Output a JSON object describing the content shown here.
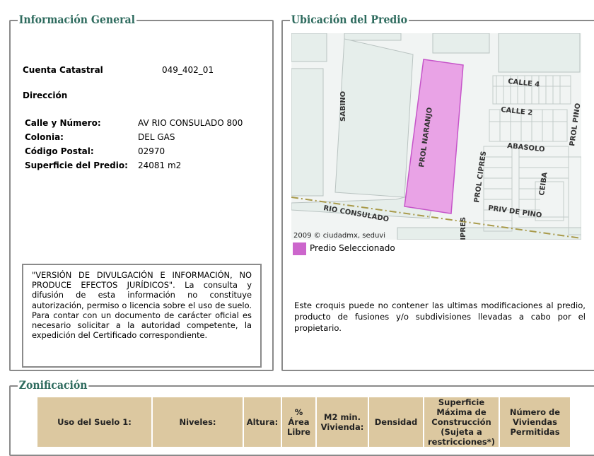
{
  "info_general": {
    "title": "Información General",
    "cuenta_label": "Cuenta Catastral",
    "cuenta_value": "049_402_01",
    "direccion_label": "Dirección",
    "fields": [
      {
        "label": "Calle y Número:",
        "value": "AV RIO CONSULADO 800"
      },
      {
        "label": "Colonia:",
        "value": "DEL GAS"
      },
      {
        "label": "Código Postal:",
        "value": "02970"
      },
      {
        "label": "Superficie del Predio:",
        "value": "24081 m2"
      }
    ],
    "disclaimer": "\"VERSIÓN DE DIVULGACIÓN E INFORMACIÓN, NO PRODUCE EFECTOS JURÍDICOS\". La consulta y difusión de esta información no constituye autorización, permiso o licencia sobre el uso de suelo. Para contar con un documento de carácter oficial es necesario solicitar a la autoridad competente, la expedición del Certificado correspondiente."
  },
  "ubicacion": {
    "title": "Ubicación del Predio",
    "map_labels": {
      "sabino": "SABINO",
      "prol_naranjo": "PROL NARANJO",
      "calle4": "CALLE 4",
      "calle2": "CALLE 2",
      "abasolo": "ABASOLO",
      "prol_pino": "PROL PINO",
      "prol_cipres": "PROL CIPRES",
      "ceiba": "CEIBA",
      "priv_de_pino": "PRIV DE PINO",
      "rio_consulado": "RIO CONSULADO",
      "cipres": "CIPRES",
      "copyright": "2009 © ciudadmx, seduvi"
    },
    "legend_label": "Predio Seleccionado",
    "legend_color": "#cc66cc",
    "note": "Este croquis puede no contener las ultimas modificaciones al predio, producto de fusiones y/o subdivisiones llevadas a cabo por el propietario."
  },
  "zonificacion": {
    "title": "Zonificación",
    "columns": [
      "Uso del Suelo 1:",
      "Niveles:",
      "Altura:",
      "% Área Libre",
      "M2 min. Vivienda:",
      "Densidad",
      "Superficie Máxima de Construcción (Sujeta a restricciones*)",
      "Número de Viviendas Permitidas"
    ]
  }
}
